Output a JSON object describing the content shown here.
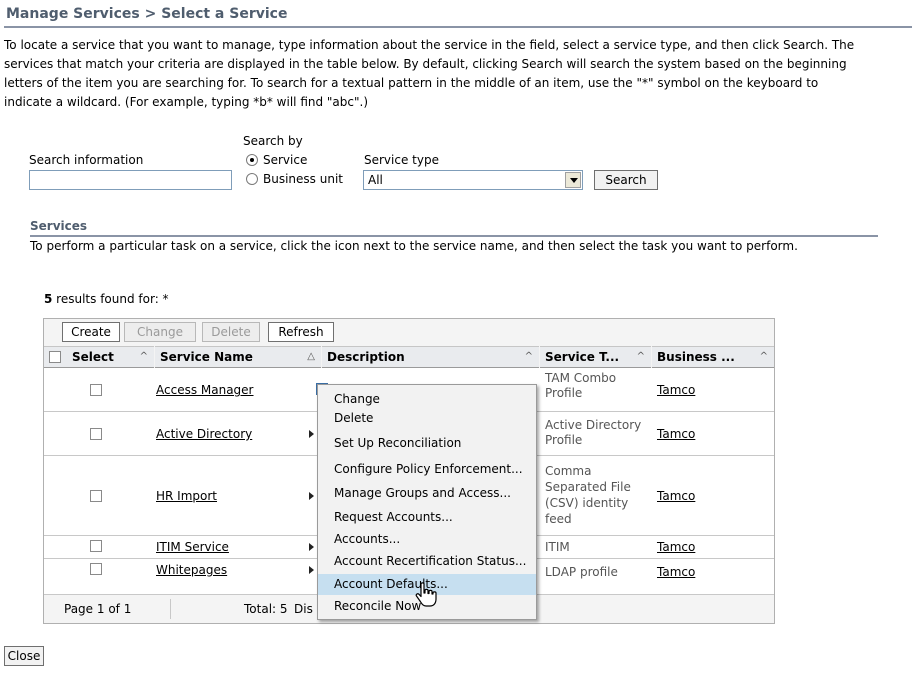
{
  "page": {
    "title": "Manage Services > Select a Service",
    "intro": [
      "To locate a service that you want to manage, type information about the service in the field, select a service type, and then click Search. The",
      "services that match your criteria are displayed in the table below. By default, clicking Search will search the system based on the beginning",
      "letters of the item you are searching for. To search for a textual pattern in the middle of an item, use the \"*\" symbol on the keyboard to",
      "indicate a wildcard. (For example, typing *b* will find \"abc\".)"
    ]
  },
  "search": {
    "info_label": "Search information",
    "info_value": "",
    "by_label": "Search by",
    "by_options": [
      "Service",
      "Business unit"
    ],
    "by_selected": "Service",
    "type_label": "Service type",
    "type_value": "All",
    "search_button": "Search"
  },
  "services": {
    "heading": "Services",
    "description": "To perform a particular task on a service, click the icon next to the service name, and then select the task you want to perform.",
    "results_count": "5",
    "results_text": " results found for: *"
  },
  "toolbar": {
    "create": "Create",
    "change": "Change",
    "delete": "Delete",
    "refresh": "Refresh"
  },
  "table": {
    "columns": [
      "Select",
      "Service Name",
      "Description",
      "Service T...",
      "Business ..."
    ],
    "rows": [
      {
        "name": "Access Manager",
        "description": "",
        "type": "TAM Combo Profile",
        "business": "Tamco"
      },
      {
        "name": "Active Directory",
        "description": "",
        "type": "Active Directory Profile",
        "business": "Tamco"
      },
      {
        "name": "HR Import",
        "description": "",
        "type": "Comma Separated File (CSV) identity feed",
        "business": "Tamco"
      },
      {
        "name": "ITIM Service",
        "description": "",
        "type": "ITIM",
        "business": "Tamco"
      },
      {
        "name": "Whitepages",
        "description": "",
        "type": "LDAP profile",
        "business": "Tamco"
      }
    ],
    "footer": {
      "page": "Page 1 of 1",
      "total": "Total: 5",
      "displayed": "Dis"
    }
  },
  "context_menu": {
    "items": [
      "Change",
      "Delete",
      "Set Up Reconciliation",
      "Configure Policy Enforcement...",
      "Manage Groups and Access...",
      "Request Accounts...",
      "Accounts...",
      "Account Recertification Status...",
      "Account Defaults...",
      "Reconcile Now"
    ],
    "highlighted": "Account Defaults..."
  },
  "close_button": "Close",
  "colors": {
    "title_text": "#4f5d6e",
    "rule": "#8a94a6",
    "menu_highlight": "#c6dff0"
  }
}
